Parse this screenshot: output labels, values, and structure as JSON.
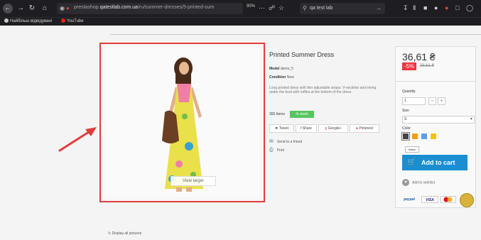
{
  "browser": {
    "url_prefix": "prestashop.",
    "url_domain": "qatestlab.com.ua",
    "url_suffix": "/ru/summer-dresses/5-printed-sum",
    "zoom": "90%",
    "search_text": "qa test lab",
    "bookmarks": [
      "Найбільш відвідувані",
      "YouTube"
    ]
  },
  "product": {
    "title": "Printed Summer Dress",
    "model_label": "Model",
    "model_value": "demo_5",
    "condition_label": "Condition",
    "condition_value": "New",
    "description": "Long printed dress with thin adjustable straps. V-neckline and wiring under the bust with ruffles at the bottom of the dress.",
    "items_text": "300 Items",
    "stock_badge": "In stock",
    "view_larger": "View larger",
    "share_buttons": [
      "Tweet",
      "Share",
      "Google+",
      "Pinterest"
    ],
    "send_to_friend": "Send to a friend",
    "print": "Print",
    "display_all": "Display all pictures"
  },
  "buy_box": {
    "price": "36,61 ₴",
    "discount": "-5%",
    "old_price": "38,61 ₴",
    "quantity_label": "Quantity",
    "quantity_value": "1",
    "size_label": "Size",
    "size_value": "S",
    "color_label": "Color",
    "colors": [
      "#444444",
      "#f39c11",
      "#5d9cec",
      "#f1c40f"
    ],
    "selected_color_tooltip": "Black",
    "add_to_cart": "Add to cart",
    "wishlist": "Add to wishlist",
    "payment_logos": [
      "paypal",
      "VISA"
    ]
  },
  "colors": {
    "accent_blue": "#1a8ed1",
    "discount_red": "#f13340",
    "stock_green": "#55c65e",
    "annotation_red": "#e23b3b"
  }
}
